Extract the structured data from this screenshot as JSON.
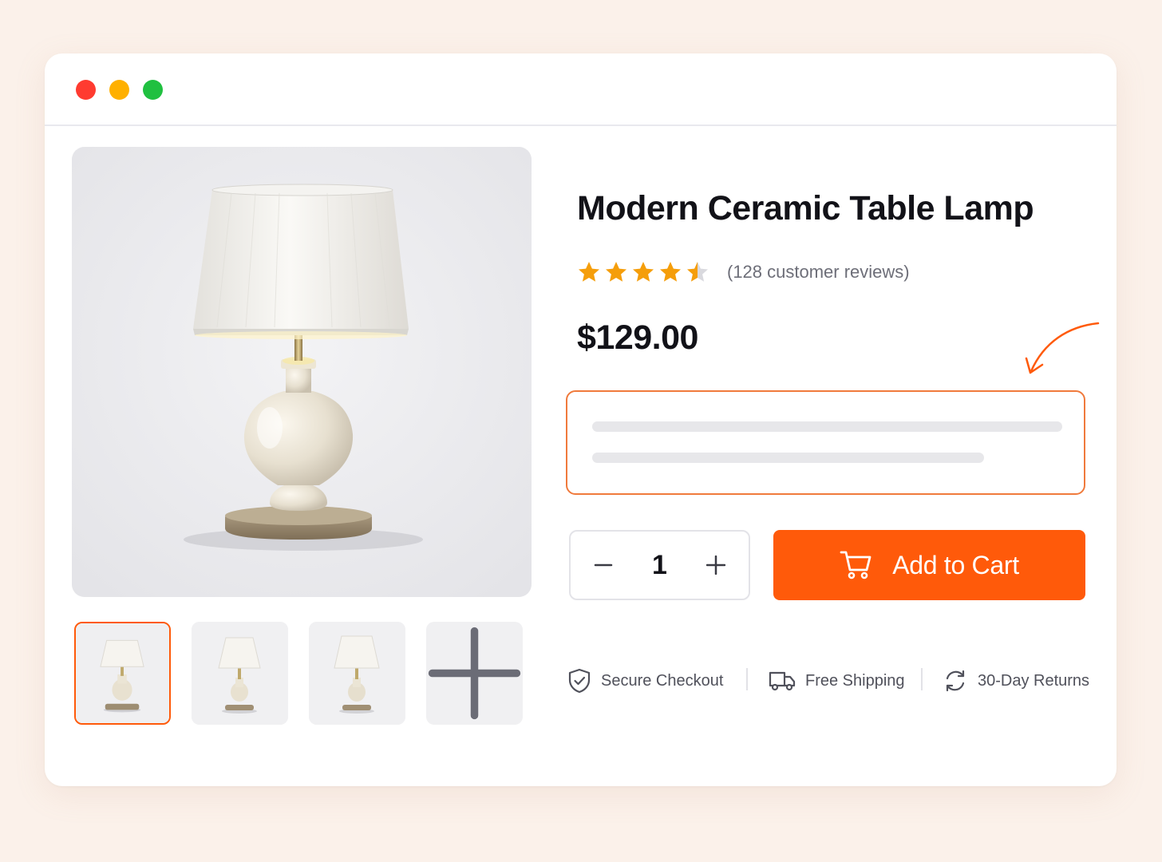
{
  "window": {
    "controls": [
      {
        "name": "close",
        "color": "#ff3b30"
      },
      {
        "name": "minimize",
        "color": "#ffb000"
      },
      {
        "name": "maximize",
        "color": "#20c040"
      }
    ]
  },
  "product": {
    "title": "Modern Ceramic Table Lamp",
    "rating": 4.5,
    "rating_max": 5,
    "review_text": "(128 customer reviews)",
    "price": "$129.00",
    "quantity": "1",
    "add_to_cart_label": "Add to Cart"
  },
  "gallery": {
    "selected_index": 0,
    "thumbnails": 3,
    "add_more_icon": "plus-icon"
  },
  "trust_badges": [
    {
      "label": "Secure Checkout",
      "icon": "shield-check-icon"
    },
    {
      "label": "Free Shipping",
      "icon": "truck-icon"
    },
    {
      "label": "30-Day Returns",
      "icon": "refresh-icon"
    }
  ],
  "colors": {
    "accent": "#ff5a0a",
    "star": "#f59e0b",
    "star_empty": "#d9d9de",
    "highlight_border": "#f07a3c"
  }
}
